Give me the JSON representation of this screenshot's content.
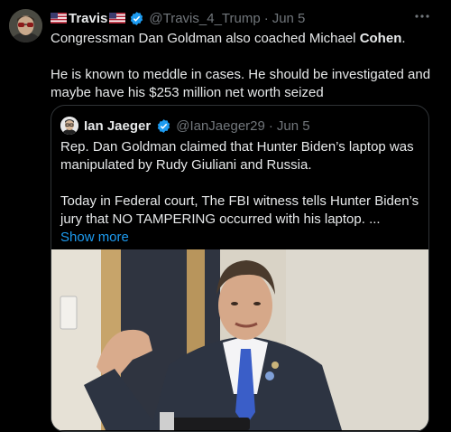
{
  "tweet": {
    "author_name": "Travis",
    "author_handle": "@Travis_4_Trump",
    "separator": "·",
    "date": "Jun 5",
    "text_line1_pre": "Congressman Dan Goldman also coached Michael ",
    "text_line1_bold": "Cohen",
    "text_line1_post": ".",
    "text_para2": "He is known to meddle in cases.  He should be investigated and maybe have his $253 million net worth seized"
  },
  "quote": {
    "author_name": "Ian Jaeger",
    "author_handle": "@IanJaeger29",
    "separator": "·",
    "date": "Jun 5",
    "para1": "Rep. Dan Goldman claimed that Hunter Biden’s laptop was manipulated by Rudy Giuliani and Russia.",
    "para2": "Today in Federal court, The FBI witness tells Hunter Biden’s jury that NO TAMPERING occurred with his laptop. ...",
    "show_more": "Show more"
  },
  "colors": {
    "background": "#000000",
    "text": "#e7e9ea",
    "secondary": "#71767b",
    "link": "#1d9bf0",
    "verified": "#1d9bf0"
  },
  "icons": [
    "us-flag-icon",
    "verified-badge-icon",
    "more-options-icon"
  ]
}
